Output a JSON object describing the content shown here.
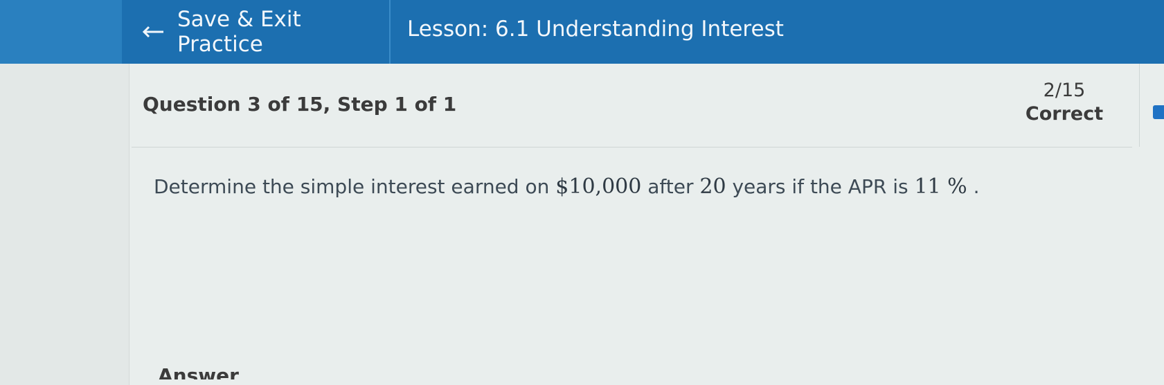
{
  "header": {
    "back_icon": "left-arrow-icon",
    "save_exit_label": "Save & Exit Practice",
    "lesson_title": "Lesson: 6.1 Understanding Interest"
  },
  "question": {
    "header": "Question 3 of 15,  Step 1 of 1",
    "text_before_principal": "Determine the simple interest earned on ",
    "principal": "$10,000",
    "text_before_years": " after ",
    "years": "20",
    "text_before_rate": " years if the APR is ",
    "rate": "11 %",
    "text_end": " ."
  },
  "score": {
    "count": "2/15",
    "label": "Correct"
  },
  "answer": {
    "label": "Answer"
  },
  "colors": {
    "topbar": "#1c6fb0",
    "accent": "#1f72c4",
    "text": "#3b3b3b"
  }
}
